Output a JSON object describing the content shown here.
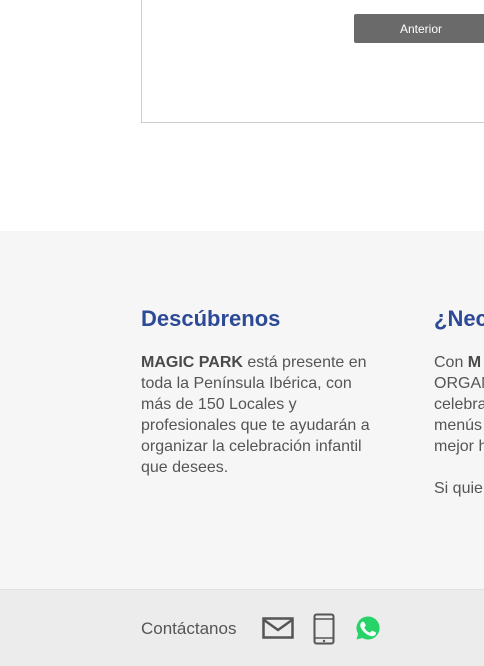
{
  "form": {
    "prev_label": "Anterior"
  },
  "discover": {
    "title": "Descúbrenos",
    "brand": "MAGIC PARK",
    "text": " está presente en toda la Península Ibérica, con más de 150 Locales y profesionales que te ayudarán a organizar la celebración infantil que desees."
  },
  "need": {
    "title": "¿Nec",
    "line1_prefix": "Con ",
    "line1_brand": "M",
    "lines": [
      "ORGAN",
      "celebra",
      "menús",
      "mejor h"
    ],
    "line_extra": "Si quie"
  },
  "contact": {
    "label": "Contáctanos",
    "icons": [
      "mail-icon",
      "phone-icon",
      "whatsapp-icon"
    ],
    "whatsapp_color": "#25d366"
  }
}
